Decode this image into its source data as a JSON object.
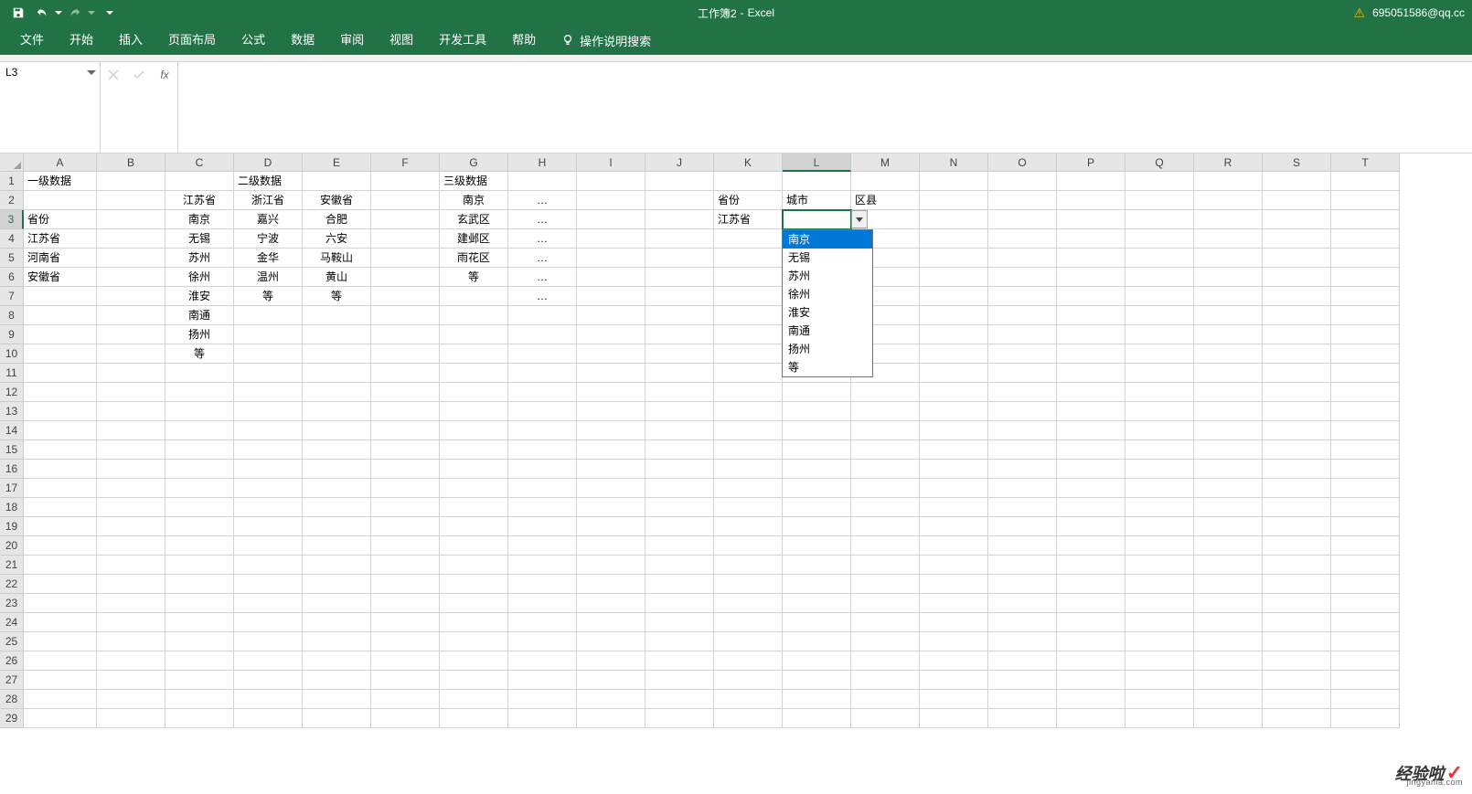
{
  "title": {
    "doc": "工作簿2",
    "sep": "-",
    "app": "Excel"
  },
  "account": "695051586@qq.cc",
  "ribbon": {
    "tabs": [
      "文件",
      "开始",
      "插入",
      "页面布局",
      "公式",
      "数据",
      "审阅",
      "视图",
      "开发工具",
      "帮助"
    ],
    "tell_me": "操作说明搜索"
  },
  "namebox": "L3",
  "formula": "",
  "columns": [
    "A",
    "B",
    "C",
    "D",
    "E",
    "F",
    "G",
    "H",
    "I",
    "J",
    "K",
    "L",
    "M",
    "N",
    "O",
    "P",
    "Q",
    "R",
    "S",
    "T"
  ],
  "col_width_default": 75,
  "selected_col": "L",
  "selected_row": 3,
  "row_count": 29,
  "cells": {
    "A1": "一级数据",
    "D1": "二级数据",
    "G1": "三级数据",
    "C2": "江苏省",
    "D2": "浙江省",
    "E2": "安徽省",
    "G2": "南京",
    "H2": "…",
    "K2": "省份",
    "L2": "城市",
    "M2": "区县",
    "A3": "省份",
    "C3": "南京",
    "D3": "嘉兴",
    "E3": "合肥",
    "G3": "玄武区",
    "H3": "…",
    "K3": "江苏省",
    "A4": "江苏省",
    "C4": "无锡",
    "D4": "宁波",
    "E4": "六安",
    "G4": "建邺区",
    "H4": "…",
    "A5": "河南省",
    "C5": "苏州",
    "D5": "金华",
    "E5": "马鞍山",
    "G5": "雨花区",
    "H5": "…",
    "A6": "安徽省",
    "C6": "徐州",
    "D6": "温州",
    "E6": "黄山",
    "G6": "等",
    "H6": "…",
    "C7": "淮安",
    "D7": "等",
    "E7": "等",
    "H7": "…",
    "C8": "南通",
    "C9": "扬州",
    "C10": "等"
  },
  "dropdown": {
    "items": [
      "南京",
      "无锡",
      "苏州",
      "徐州",
      "淮安",
      "南通",
      "扬州",
      "等"
    ],
    "highlighted": 0
  },
  "watermark": {
    "text": "经验啦",
    "url": "jingyanla.com"
  }
}
